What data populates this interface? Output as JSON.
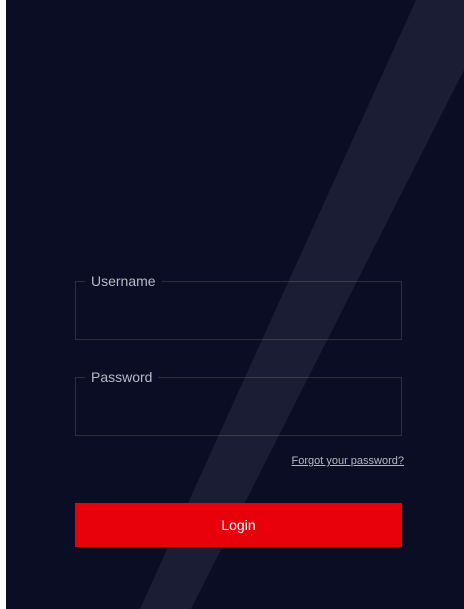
{
  "form": {
    "username_label": "Username",
    "username_value": "",
    "password_label": "Password",
    "password_value": "",
    "forgot_link": "Forgot your password?",
    "login_label": "Login"
  },
  "colors": {
    "background": "#0a0d24",
    "beam": "#1a1d33",
    "field_border": "#2d3044",
    "label_text": "#b7bac6",
    "link_text": "#b3b7c4",
    "primary_button": "#e8000b",
    "button_text": "#ffffff"
  }
}
